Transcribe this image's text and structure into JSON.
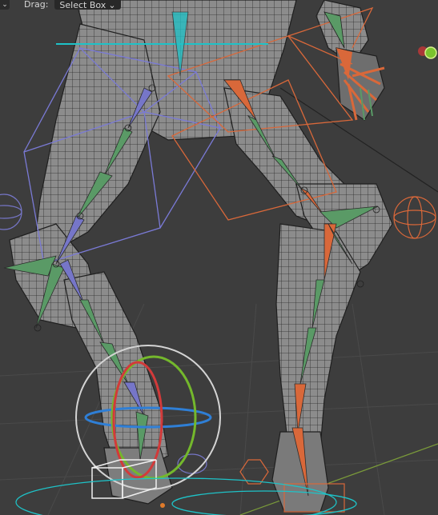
{
  "toolbar": {
    "menu_chevron": "⌄",
    "drag_label": "Drag:",
    "drag_value": "Select Box",
    "drag_chevron": "⌄"
  },
  "colors": {
    "background": "#3d3d3d",
    "mesh": "#8a8a8a",
    "wire": "#1e1e1e",
    "bone_green": "#5a9a66",
    "bone_blue": "#7676c8",
    "bone_orange": "#d9683a",
    "cyan": "#1ec3c8",
    "gizmo_red": "#d23a3a",
    "gizmo_green": "#74b82c",
    "gizmo_blue": "#2f7fd6"
  }
}
